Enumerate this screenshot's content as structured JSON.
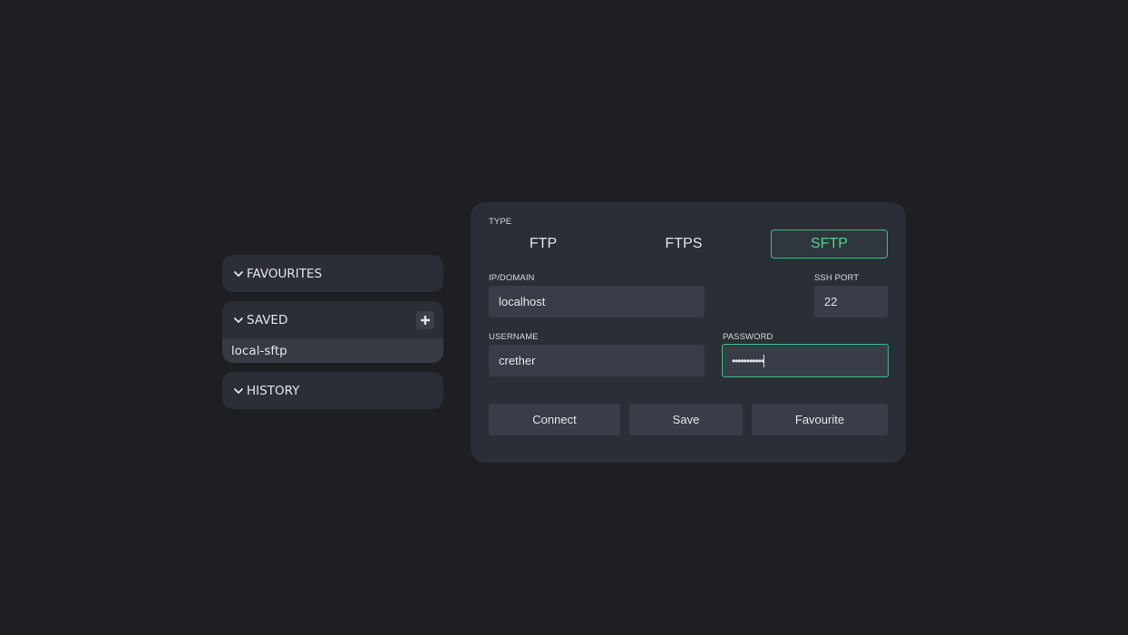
{
  "sidebar": {
    "favourites": {
      "label": "FAVOURITES"
    },
    "saved": {
      "label": "SAVED",
      "items": [
        {
          "label": "local-sftp"
        }
      ]
    },
    "history": {
      "label": "HISTORY"
    }
  },
  "connection": {
    "type_label": "TYPE",
    "types": [
      {
        "label": "FTP",
        "active": false
      },
      {
        "label": "FTPS",
        "active": false
      },
      {
        "label": "SFTP",
        "active": true
      }
    ],
    "host": {
      "label": "IP/DOMAIN",
      "value": "localhost"
    },
    "port": {
      "label": "SSH PORT",
      "value": "22"
    },
    "username": {
      "label": "USERNAME",
      "value": "crether"
    },
    "password": {
      "label": "PASSWORD",
      "value": "•••••••••••"
    },
    "actions": {
      "connect": "Connect",
      "save": "Save",
      "favourite": "Favourite"
    }
  },
  "colors": {
    "background": "#1e1f23",
    "panel": "#2a2e36",
    "input": "#383d47",
    "accent": "#3fbf7f"
  }
}
